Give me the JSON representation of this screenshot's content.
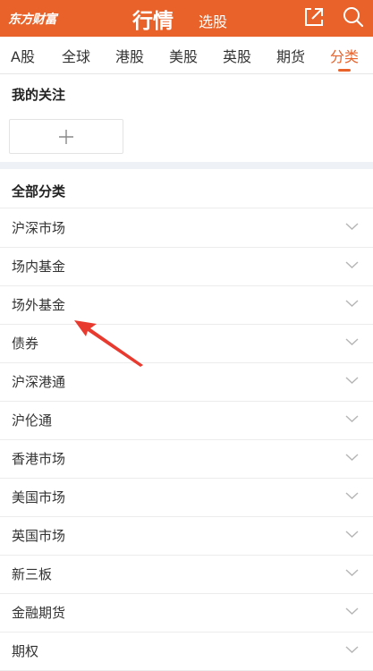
{
  "header": {
    "logo_text": "东方财富",
    "title": "行情",
    "subtitle": "选股",
    "accent_color": "#e8622a",
    "share_icon": "share-icon",
    "search_icon": "search-icon"
  },
  "tabs": [
    {
      "label": "A股",
      "active": false
    },
    {
      "label": "全球",
      "active": false
    },
    {
      "label": "港股",
      "active": false
    },
    {
      "label": "美股",
      "active": false
    },
    {
      "label": "英股",
      "active": false
    },
    {
      "label": "期货",
      "active": false
    },
    {
      "label": "分类",
      "active": true
    }
  ],
  "watchlist": {
    "title": "我的关注",
    "add_icon": "plus-icon"
  },
  "categories": {
    "title": "全部分类",
    "items": [
      {
        "label": "沪深市场"
      },
      {
        "label": "场内基金"
      },
      {
        "label": "场外基金"
      },
      {
        "label": "债券"
      },
      {
        "label": "沪深港通"
      },
      {
        "label": "沪伦通"
      },
      {
        "label": "香港市场"
      },
      {
        "label": "美国市场"
      },
      {
        "label": "英国市场"
      },
      {
        "label": "新三板"
      },
      {
        "label": "金融期货"
      },
      {
        "label": "期权"
      }
    ]
  },
  "annotation_color": "#e83a2e"
}
